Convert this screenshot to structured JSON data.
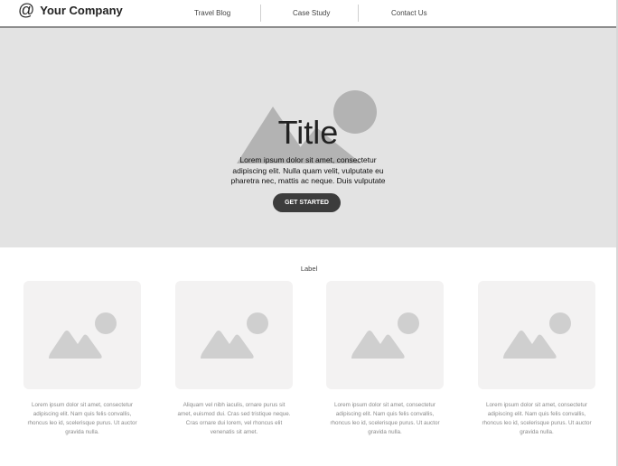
{
  "header": {
    "logo_icon": "at-sign-icon",
    "company_name": "Your Company",
    "nav": [
      {
        "label": "Travel Blog"
      },
      {
        "label": "Case Study"
      },
      {
        "label": "Contact Us"
      }
    ]
  },
  "hero": {
    "title": "Title",
    "text": "Lorem ipsum dolor sit amet, consectetur adipiscing elit. Nulla quam velit, vulputate eu pharetra nec, mattis ac neque. Duis vulputate commodo lectus, ac blandit elit tincidunt id.",
    "cta_label": "GET STARTED",
    "image_icon": "image-placeholder-icon"
  },
  "section": {
    "label": "Label",
    "cards": [
      {
        "image_icon": "image-placeholder-icon",
        "text": "Lorem ipsum dolor sit amet, consectetur adipiscing elit. Nam quis felis convallis, rhoncus leo id, scelerisque purus. Ut auctor gravida nulla."
      },
      {
        "image_icon": "image-placeholder-icon",
        "text": "Aliquam vel nibh iaculis, ornare purus sit amet, euismod dui. Cras sed tristique neque. Cras ornare dui lorem, vel rhoncus elit venenatis sit amet."
      },
      {
        "image_icon": "image-placeholder-icon",
        "text": "Lorem ipsum dolor sit amet, consectetur adipiscing elit. Nam quis felis convallis, rhoncus leo id, scelerisque purus. Ut auctor gravida nulla."
      },
      {
        "image_icon": "image-placeholder-icon",
        "text": "Lorem ipsum dolor sit amet, consectetur adipiscing elit. Nam quis felis convallis, rhoncus leo id, scelerisque purus. Ut auctor gravida nulla."
      }
    ]
  },
  "colors": {
    "hero_bg": "#e3e3e3",
    "placeholder_shape": "#b3b3b3",
    "card_bg": "#f3f2f2",
    "card_shape": "#cfcfcf",
    "button_bg": "#3c3c3c"
  }
}
